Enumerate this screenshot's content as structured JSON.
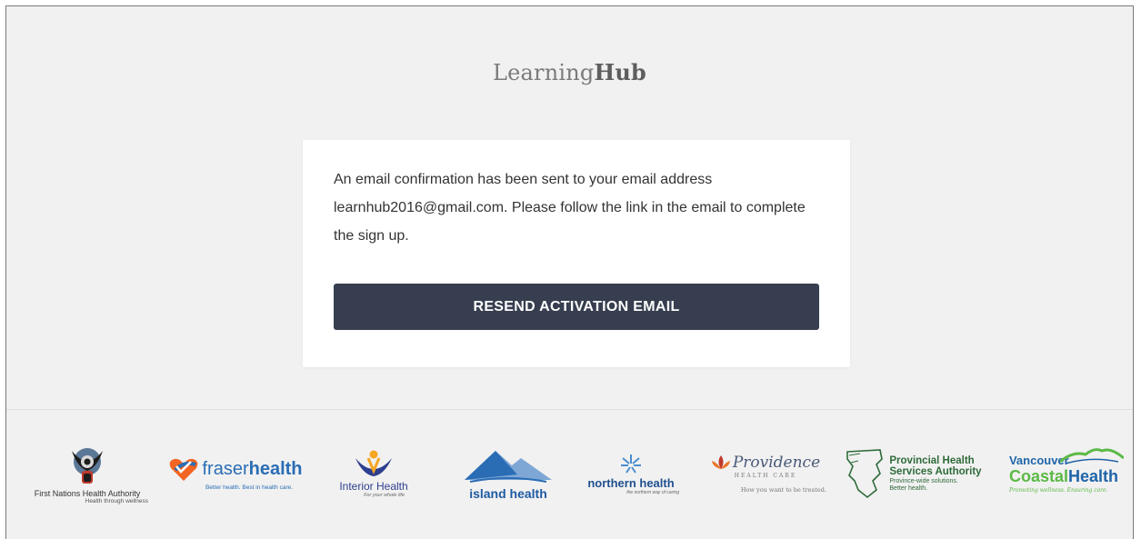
{
  "header": {
    "brand_light": "Learning",
    "brand_bold": "Hub"
  },
  "card": {
    "message": "An email confirmation has been sent to your email address learnhub2016@gmail.com. Please follow the link in the email to complete the sign up.",
    "resend_button_label": "RESEND ACTIVATION EMAIL"
  },
  "footer": {
    "logos": [
      {
        "name": "First Nations Health Authority",
        "tagline": "Health through wellness"
      },
      {
        "name_light": "fraser",
        "name_bold": "health",
        "tagline": "Better health. Best in health care."
      },
      {
        "name": "Interior Health",
        "tagline": "For your whole life"
      },
      {
        "name": "island health"
      },
      {
        "name": "northern health",
        "tagline": "the northern way of caring"
      },
      {
        "name": "Providence",
        "subname": "HEALTH CARE",
        "tagline": "How you want to be treated."
      },
      {
        "name_line1": "Provincial Health",
        "name_line2": "Services Authority",
        "tagline_line1": "Province-wide solutions.",
        "tagline_line2": "Better health."
      },
      {
        "name_line1": "Vancouver",
        "name_line2_a": "Coastal",
        "name_line2_b": "Health",
        "tagline": "Promoting wellness. Ensuring care."
      }
    ]
  },
  "colors": {
    "page_bg": "#f1f1f1",
    "button_bg": "#363e4f",
    "fraser_orange": "#f26522",
    "island_blue": "#2a6db5",
    "phsa_green": "#2f6b3a",
    "vch_blue": "#1f64a8",
    "vch_green": "#5cb947"
  }
}
